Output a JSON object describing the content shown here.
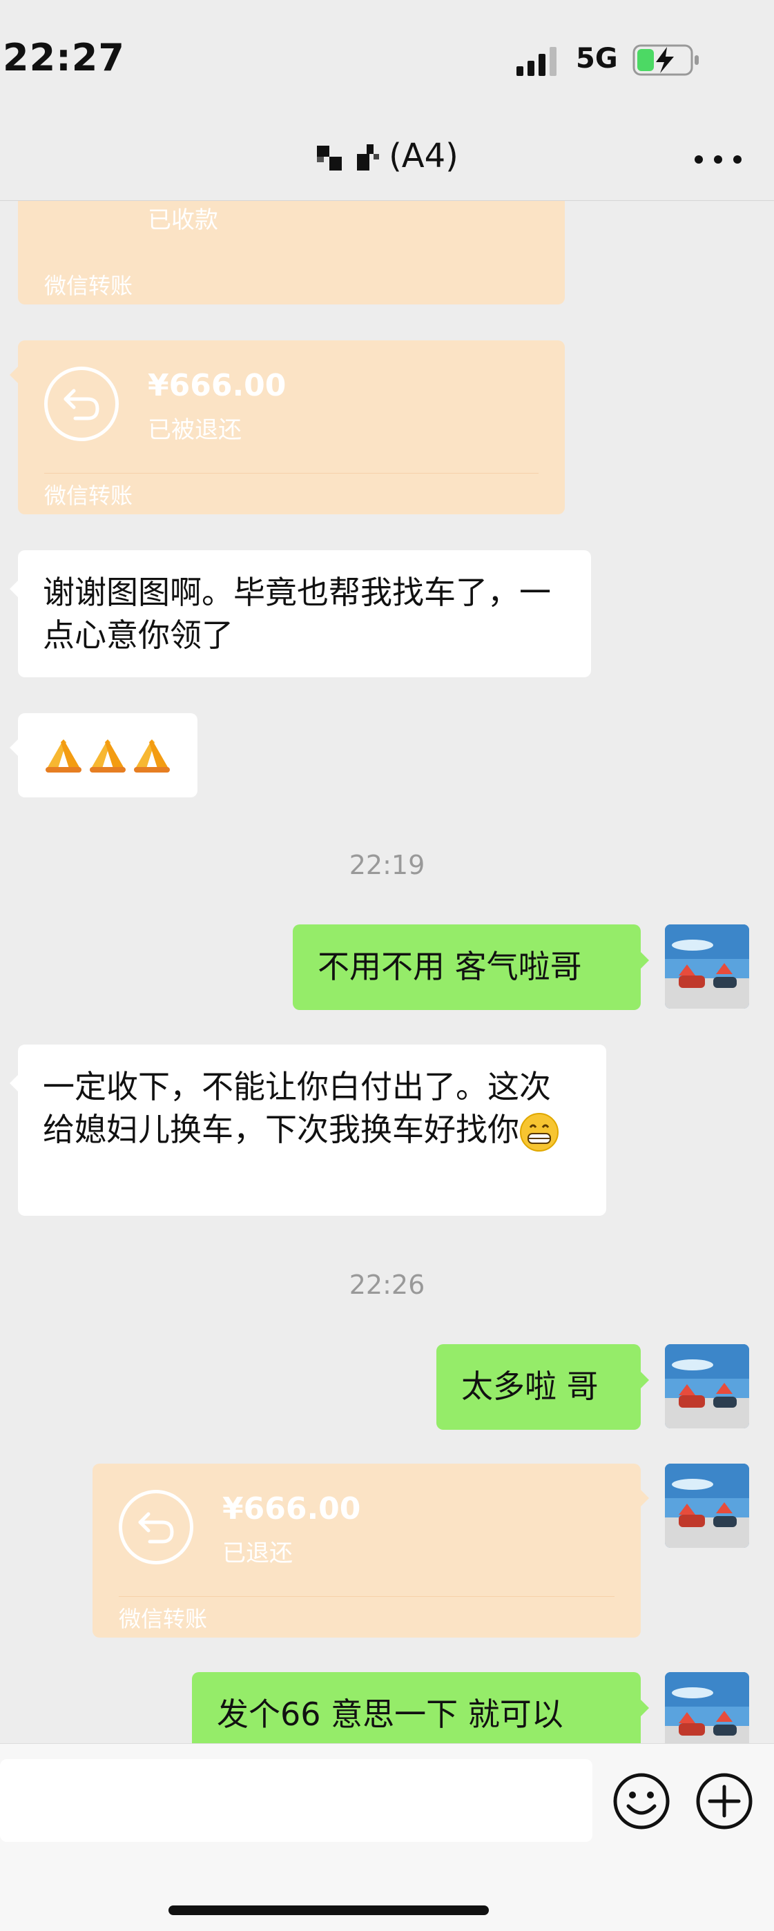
{
  "status_bar": {
    "time": "22:27",
    "network": "5G"
  },
  "header": {
    "title": "(A4)"
  },
  "messages": {
    "transfer1": {
      "status": "已收款",
      "footer": "微信转账"
    },
    "transfer2": {
      "amount": "¥666.00",
      "status": "已被退还",
      "footer": "微信转账"
    },
    "msg1": {
      "text": "谢谢图图啊。毕竟也帮我找车了，一点心意你领了"
    },
    "time1": "22:19",
    "msg3": {
      "text": "不用不用 客气啦哥"
    },
    "msg4": {
      "text": "一定收下，不能让你白付出了。这次给媳妇儿换车，下次我换车好找你"
    },
    "time2": "22:26",
    "msg5": {
      "text": "太多啦 哥"
    },
    "transfer3": {
      "amount": "¥666.00",
      "status": "已退还",
      "footer": "微信转账"
    },
    "msg6": {
      "text": "发个66 意思一下 就可以"
    }
  },
  "colors": {
    "background": "#ededed",
    "green_bubble": "#95ec69",
    "transfer_bubble": "#fbe3c5"
  },
  "icons": {
    "more": "more-icon",
    "emoji": "emoji-icon",
    "plus": "plus-icon",
    "refund": "refund-arrow-icon"
  }
}
